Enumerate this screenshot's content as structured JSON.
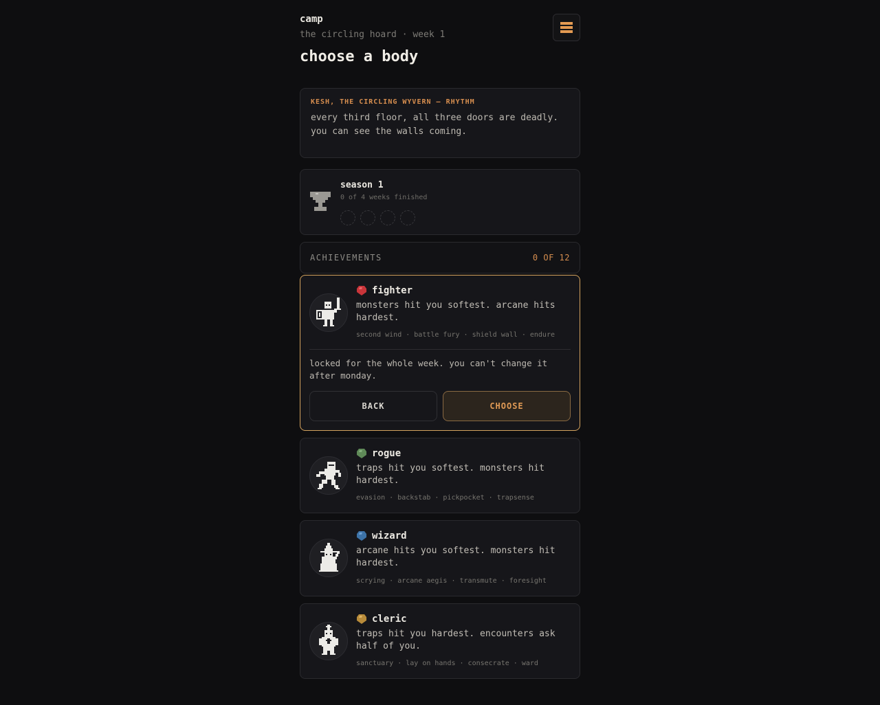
{
  "header": {
    "camp": "camp",
    "subtitle": "the circling hoard · week 1",
    "title": "choose a body",
    "menu_icon": "hamburger-menu-icon"
  },
  "boss": {
    "kicker": "KESH, THE CIRCLING WYVERN — RHYTHM",
    "description": "every third floor, all three doors are deadly. you can see the walls coming."
  },
  "season": {
    "icon": "trophy-icon",
    "name": "season 1",
    "progress": "0 of 4 weeks finished",
    "weeks_finished": 0,
    "weeks_total": 4
  },
  "achievements": {
    "label": "ACHIEVEMENTS",
    "count": "0 OF 12"
  },
  "colors": {
    "accent": "#d78e4f",
    "selected_border": "#d4a35e",
    "fighter": "#c9353a",
    "rogue": "#5f8a58",
    "wizard": "#3d73a8",
    "cleric": "#b88b3a"
  },
  "classes": [
    {
      "name": "fighter",
      "description": "monsters hit you softest. arcane hits hardest.",
      "skills": "second wind · battle fury · shield wall · endure"
    },
    {
      "name": "rogue",
      "description": "traps hit you softest. monsters hit hardest.",
      "skills": "evasion · backstab · pickpocket · trapsense"
    },
    {
      "name": "wizard",
      "description": "arcane hits you softest. monsters hit hardest.",
      "skills": "scrying · arcane aegis · transmute · foresight"
    },
    {
      "name": "cleric",
      "description": "traps hit you hardest. encounters ask half of you.",
      "skills": "sanctuary · lay on hands · consecrate · ward"
    }
  ],
  "confirm": {
    "message": "locked for the whole week. you can't change it after monday.",
    "back_label": "BACK",
    "choose_label": "CHOOSE"
  }
}
